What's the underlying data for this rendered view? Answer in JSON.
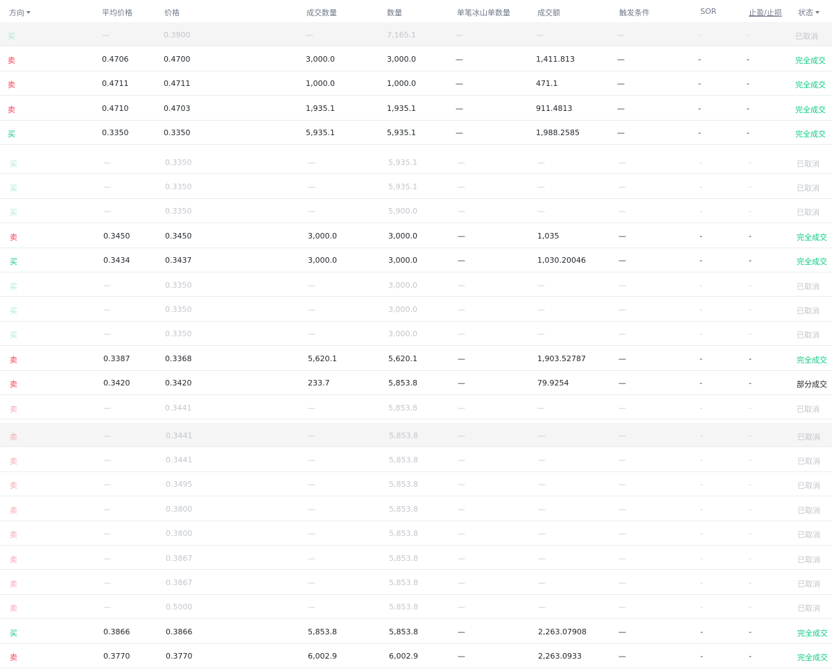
{
  "columns": [
    {
      "key": "side",
      "label": "方向",
      "sortable": true
    },
    {
      "key": "avg",
      "label": "平均价格"
    },
    {
      "key": "price",
      "label": "价格"
    },
    {
      "key": "filled",
      "label": "成交数量"
    },
    {
      "key": "qty",
      "label": "数量"
    },
    {
      "key": "iceberg",
      "label": "单笔冰山单数量"
    },
    {
      "key": "amount",
      "label": "成交额"
    },
    {
      "key": "trigger",
      "label": "触发条件"
    },
    {
      "key": "sor",
      "label": "SOR"
    },
    {
      "key": "tpsl",
      "label": "止盈/止损",
      "underline": true
    },
    {
      "key": "status",
      "label": "状态",
      "sortable": true
    }
  ],
  "groups": [
    {
      "rows": [
        {
          "side": "买",
          "sideType": "buy",
          "avg": "—",
          "price": "0.3900",
          "filled": "—",
          "qty": "7,165.1",
          "iceberg": "—",
          "amount": "—",
          "trigger": "—",
          "sor": "-",
          "tpsl": "-",
          "status": "已取消",
          "statusType": "cancel",
          "highlight": true
        },
        {
          "side": "卖",
          "sideType": "sell",
          "avg": "0.4706",
          "price": "0.4700",
          "filled": "3,000.0",
          "qty": "3,000.0",
          "iceberg": "—",
          "amount": "1,411.813",
          "trigger": "—",
          "sor": "-",
          "tpsl": "-",
          "status": "完全成交",
          "statusType": "filled"
        },
        {
          "side": "卖",
          "sideType": "sell",
          "avg": "0.4711",
          "price": "0.4711",
          "filled": "1,000.0",
          "qty": "1,000.0",
          "iceberg": "—",
          "amount": "471.1",
          "trigger": "—",
          "sor": "-",
          "tpsl": "-",
          "status": "完全成交",
          "statusType": "filled"
        },
        {
          "side": "卖",
          "sideType": "sell",
          "avg": "0.4710",
          "price": "0.4703",
          "filled": "1,935.1",
          "qty": "1,935.1",
          "iceberg": "—",
          "amount": "911.4813",
          "trigger": "—",
          "sor": "-",
          "tpsl": "-",
          "status": "完全成交",
          "statusType": "filled"
        },
        {
          "side": "买",
          "sideType": "buy",
          "avg": "0.3350",
          "price": "0.3350",
          "filled": "5,935.1",
          "qty": "5,935.1",
          "iceberg": "—",
          "amount": "1,988.2585",
          "trigger": "—",
          "sor": "-",
          "tpsl": "-",
          "status": "完全成交",
          "statusType": "filled"
        }
      ]
    },
    {
      "rows": [
        {
          "side": "买",
          "sideType": "buy",
          "avg": "—",
          "price": "0.3350",
          "filled": "—",
          "qty": "5,935.1",
          "iceberg": "—",
          "amount": "—",
          "trigger": "—",
          "sor": "-",
          "tpsl": "-",
          "status": "已取消",
          "statusType": "cancel"
        },
        {
          "side": "买",
          "sideType": "buy",
          "avg": "—",
          "price": "0.3350",
          "filled": "—",
          "qty": "5,935.1",
          "iceberg": "—",
          "amount": "—",
          "trigger": "—",
          "sor": "-",
          "tpsl": "-",
          "status": "已取消",
          "statusType": "cancel"
        },
        {
          "side": "买",
          "sideType": "buy",
          "avg": "—",
          "price": "0.3350",
          "filled": "—",
          "qty": "5,900.0",
          "iceberg": "—",
          "amount": "—",
          "trigger": "—",
          "sor": "-",
          "tpsl": "-",
          "status": "已取消",
          "statusType": "cancel"
        },
        {
          "side": "卖",
          "sideType": "sell",
          "avg": "0.3450",
          "price": "0.3450",
          "filled": "3,000.0",
          "qty": "3,000.0",
          "iceberg": "—",
          "amount": "1,035",
          "trigger": "—",
          "sor": "-",
          "tpsl": "-",
          "status": "完全成交",
          "statusType": "filled"
        },
        {
          "side": "买",
          "sideType": "buy",
          "avg": "0.3434",
          "price": "0.3437",
          "filled": "3,000.0",
          "qty": "3,000.0",
          "iceberg": "—",
          "amount": "1,030.20046",
          "trigger": "—",
          "sor": "-",
          "tpsl": "-",
          "status": "完全成交",
          "statusType": "filled"
        },
        {
          "side": "买",
          "sideType": "buy",
          "avg": "—",
          "price": "0.3350",
          "filled": "—",
          "qty": "3,000.0",
          "iceberg": "—",
          "amount": "—",
          "trigger": "—",
          "sor": "-",
          "tpsl": "-",
          "status": "已取消",
          "statusType": "cancel"
        },
        {
          "side": "买",
          "sideType": "buy",
          "avg": "—",
          "price": "0.3350",
          "filled": "—",
          "qty": "3,000.0",
          "iceberg": "—",
          "amount": "—",
          "trigger": "—",
          "sor": "-",
          "tpsl": "-",
          "status": "已取消",
          "statusType": "cancel"
        },
        {
          "side": "买",
          "sideType": "buy",
          "avg": "—",
          "price": "0.3350",
          "filled": "—",
          "qty": "3,000.0",
          "iceberg": "—",
          "amount": "—",
          "trigger": "—",
          "sor": "-",
          "tpsl": "-",
          "status": "已取消",
          "statusType": "cancel"
        },
        {
          "side": "卖",
          "sideType": "sell",
          "avg": "0.3387",
          "price": "0.3368",
          "filled": "5,620.1",
          "qty": "5,620.1",
          "iceberg": "—",
          "amount": "1,903.52787",
          "trigger": "—",
          "sor": "-",
          "tpsl": "-",
          "status": "完全成交",
          "statusType": "filled"
        },
        {
          "side": "卖",
          "sideType": "sell",
          "avg": "0.3420",
          "price": "0.3420",
          "filled": "233.7",
          "qty": "5,853.8",
          "iceberg": "—",
          "amount": "79.9254",
          "trigger": "—",
          "sor": "-",
          "tpsl": "-",
          "status": "部分成交",
          "statusType": "partial"
        },
        {
          "side": "卖",
          "sideType": "sell",
          "avg": "—",
          "price": "0.3441",
          "filled": "—",
          "qty": "5,853.8",
          "iceberg": "—",
          "amount": "—",
          "trigger": "—",
          "sor": "-",
          "tpsl": "-",
          "status": "已取消",
          "statusType": "cancel"
        }
      ]
    },
    {
      "rows": [
        {
          "side": "卖",
          "sideType": "sell",
          "avg": "—",
          "price": "0.3441",
          "filled": "—",
          "qty": "5,853.8",
          "iceberg": "—",
          "amount": "—",
          "trigger": "—",
          "sor": "-",
          "tpsl": "-",
          "status": "已取消",
          "statusType": "cancel",
          "highlight": true
        },
        {
          "side": "卖",
          "sideType": "sell",
          "avg": "—",
          "price": "0.3441",
          "filled": "—",
          "qty": "5,853.8",
          "iceberg": "—",
          "amount": "—",
          "trigger": "—",
          "sor": "-",
          "tpsl": "-",
          "status": "已取消",
          "statusType": "cancel"
        },
        {
          "side": "卖",
          "sideType": "sell",
          "avg": "—",
          "price": "0.3495",
          "filled": "—",
          "qty": "5,853.8",
          "iceberg": "—",
          "amount": "—",
          "trigger": "—",
          "sor": "-",
          "tpsl": "-",
          "status": "已取消",
          "statusType": "cancel"
        },
        {
          "side": "卖",
          "sideType": "sell",
          "avg": "—",
          "price": "0.3800",
          "filled": "—",
          "qty": "5,853.8",
          "iceberg": "—",
          "amount": "—",
          "trigger": "—",
          "sor": "-",
          "tpsl": "-",
          "status": "已取消",
          "statusType": "cancel"
        },
        {
          "side": "卖",
          "sideType": "sell",
          "avg": "—",
          "price": "0.3800",
          "filled": "—",
          "qty": "5,853.8",
          "iceberg": "—",
          "amount": "—",
          "trigger": "—",
          "sor": "-",
          "tpsl": "-",
          "status": "已取消",
          "statusType": "cancel"
        },
        {
          "side": "卖",
          "sideType": "sell",
          "avg": "—",
          "price": "0.3867",
          "filled": "—",
          "qty": "5,853.8",
          "iceberg": "—",
          "amount": "—",
          "trigger": "—",
          "sor": "-",
          "tpsl": "-",
          "status": "已取消",
          "statusType": "cancel"
        },
        {
          "side": "卖",
          "sideType": "sell",
          "avg": "—",
          "price": "0.3867",
          "filled": "—",
          "qty": "5,853.8",
          "iceberg": "—",
          "amount": "—",
          "trigger": "—",
          "sor": "-",
          "tpsl": "-",
          "status": "已取消",
          "statusType": "cancel"
        },
        {
          "side": "卖",
          "sideType": "sell",
          "avg": "—",
          "price": "0.5000",
          "filled": "—",
          "qty": "5,853.8",
          "iceberg": "—",
          "amount": "—",
          "trigger": "—",
          "sor": "-",
          "tpsl": "-",
          "status": "已取消",
          "statusType": "cancel"
        },
        {
          "side": "买",
          "sideType": "buy",
          "avg": "0.3866",
          "price": "0.3866",
          "filled": "5,853.8",
          "qty": "5,853.8",
          "iceberg": "—",
          "amount": "2,263.07908",
          "trigger": "—",
          "sor": "-",
          "tpsl": "-",
          "status": "完全成交",
          "statusType": "filled"
        },
        {
          "side": "卖",
          "sideType": "sell",
          "avg": "0.3770",
          "price": "0.3770",
          "filled": "6,002.9",
          "qty": "6,002.9",
          "iceberg": "—",
          "amount": "2,263.0933",
          "trigger": "—",
          "sor": "-",
          "tpsl": "-",
          "status": "完全成交",
          "statusType": "filled"
        }
      ]
    }
  ]
}
